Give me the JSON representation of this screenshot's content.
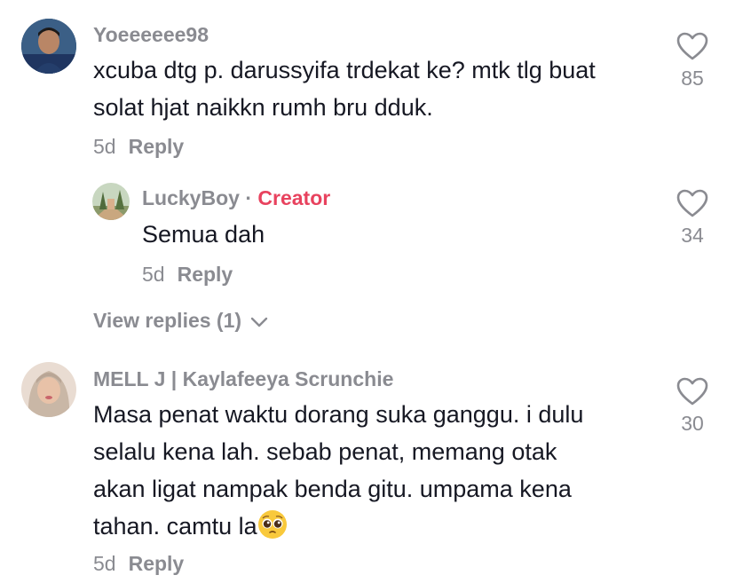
{
  "comments": [
    {
      "username": "Yoeeeeee98",
      "line1": "xcuba dtg p. darussyifa trdekat ke? mtk tlg buat",
      "line2": "solat hjat naikkn rumh bru dduk.",
      "age": "5d",
      "reply_label": "Reply",
      "likes": "85",
      "icon": "heart-outline-icon"
    },
    {
      "username": "LuckyBoy",
      "separator": "·",
      "badge": "Creator",
      "text": "Semua dah",
      "age": "5d",
      "reply_label": "Reply",
      "likes": "34",
      "icon": "heart-outline-icon"
    },
    {
      "username": "MELL J | Kaylafeeya Scrunchie",
      "line1": "Masa penat waktu dorang suka ganggu. i dulu",
      "line2": "selalu kena lah. sebab penat, memang otak",
      "line3": "akan ligat nampak benda gitu. umpama kena",
      "line4": "tahan. camtu la",
      "emoji": "pleading-face-emoji",
      "age": "5d",
      "reply_label": "Reply",
      "likes": "30",
      "icon": "heart-outline-icon"
    }
  ],
  "view_replies": "View replies (1)",
  "colors": {
    "creator": "#e8425e",
    "muted": "#8a8b91",
    "text": "#161823"
  }
}
